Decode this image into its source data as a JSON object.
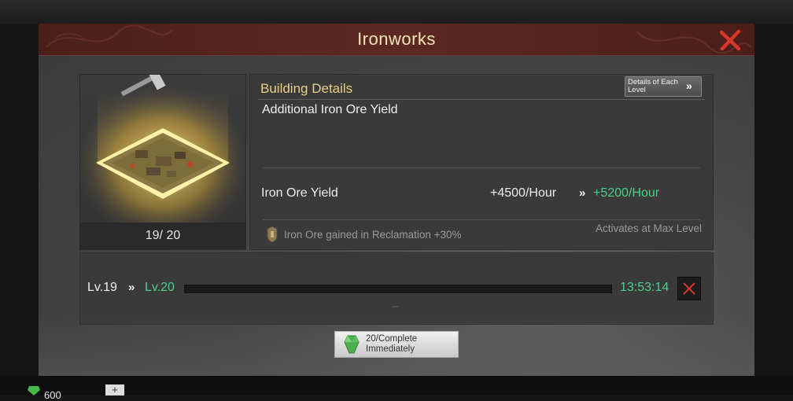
{
  "dialog": {
    "title": "Ironworks",
    "building_level": "19/ 20",
    "details": {
      "title": "Building Details",
      "level_button_label": "Details of Each Level",
      "level_button_icon": "chevron-double-right-icon",
      "description": "Additional Iron Ore Yield",
      "stat": {
        "name": "Iron Ore Yield",
        "current": "+4500/Hour",
        "arrow": "»",
        "next": "+5200/Hour"
      },
      "bonus_text": "Iron Ore gained in Reclamation +30%",
      "max_note": "Activates at Max Level"
    },
    "upgrade": {
      "current_level": "Lv.19",
      "arrow": "»",
      "next_level": "Lv.20",
      "timer": "13:53:14",
      "progress": 0.0,
      "subtext": "--"
    },
    "complete_button": {
      "line1": "20/Complete",
      "line2": "Immediately",
      "icon": "green-gem-icon"
    }
  },
  "resources": {
    "gem_count": "600",
    "plus_label": "+"
  },
  "colors": {
    "accent_green": "#4bd08a",
    "title_gold": "#e9cf83",
    "header_red": "#5e2822",
    "close_red": "#d7362c"
  }
}
